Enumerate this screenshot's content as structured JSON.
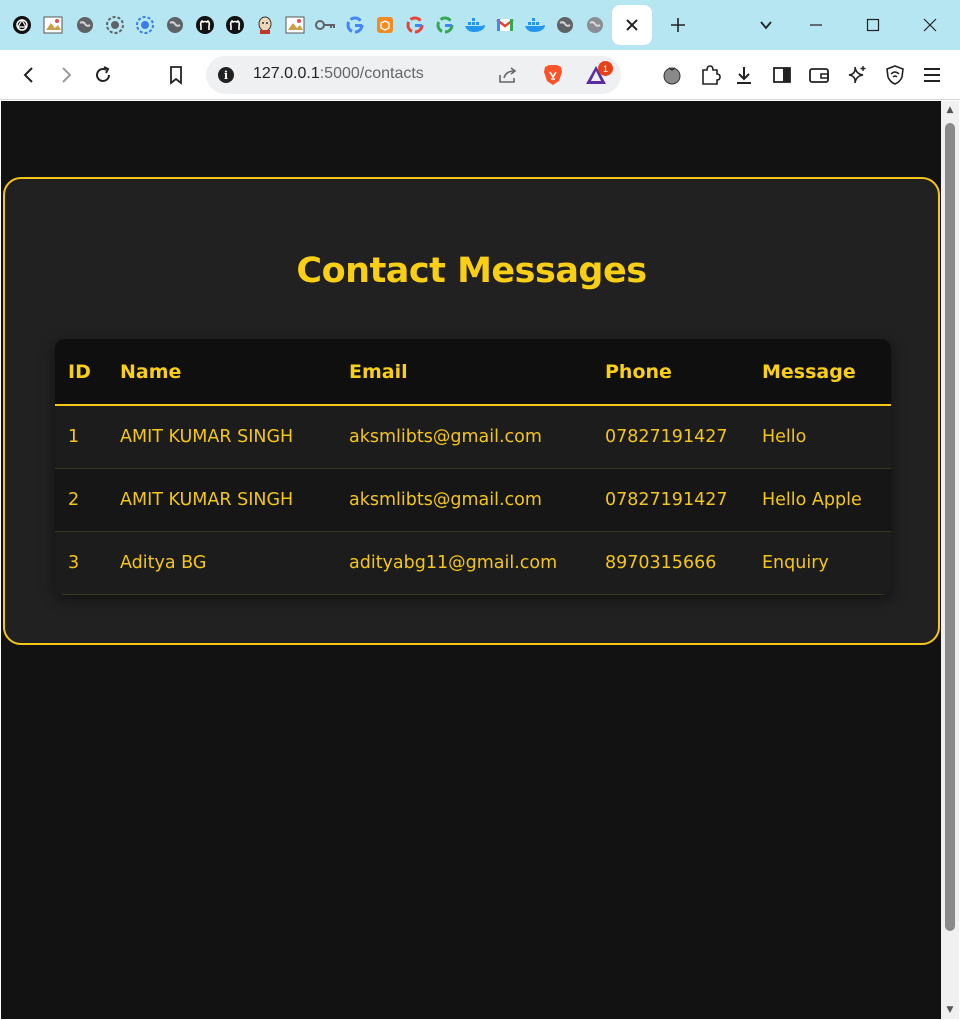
{
  "browser": {
    "tabs": [
      {
        "icon": "openai-icon"
      },
      {
        "icon": "image-icon"
      },
      {
        "icon": "globe-icon"
      },
      {
        "icon": "settings-globe-icon"
      },
      {
        "icon": "blue-gear-icon"
      },
      {
        "icon": "globe-icon"
      },
      {
        "icon": "github-icon"
      },
      {
        "icon": "github-icon"
      },
      {
        "icon": "jenkins-icon"
      },
      {
        "icon": "image-icon"
      },
      {
        "icon": "key-icon"
      },
      {
        "icon": "google-icon"
      },
      {
        "icon": "box-icon"
      },
      {
        "icon": "google-icon"
      },
      {
        "icon": "google-icon"
      },
      {
        "icon": "docker-icon"
      },
      {
        "icon": "gmail-icon"
      },
      {
        "icon": "docker-icon"
      },
      {
        "icon": "globe-icon"
      },
      {
        "icon": "globe-icon"
      }
    ],
    "active_tab_icon": "close-icon",
    "url_host": "127.0.0.1",
    "url_path": ":5000/contacts",
    "brave_rewards_badge": "1"
  },
  "page": {
    "title": "Contact Messages",
    "table": {
      "headers": [
        "ID",
        "Name",
        "Email",
        "Phone",
        "Message"
      ],
      "rows": [
        [
          "1",
          "AMIT KUMAR SINGH",
          "aksmlibts@gmail.com",
          "07827191427",
          "Hello"
        ],
        [
          "2",
          "AMIT KUMAR SINGH",
          "aksmlibts@gmail.com",
          "07827191427",
          "Hello Apple"
        ],
        [
          "3",
          "Aditya BG",
          "adityabg11@gmail.com",
          "8970315666",
          "Enquiry"
        ]
      ]
    }
  },
  "colors": {
    "accent": "#f5c518",
    "background": "#121212",
    "card": "#212121",
    "tabstrip": "#b6e6f2"
  }
}
